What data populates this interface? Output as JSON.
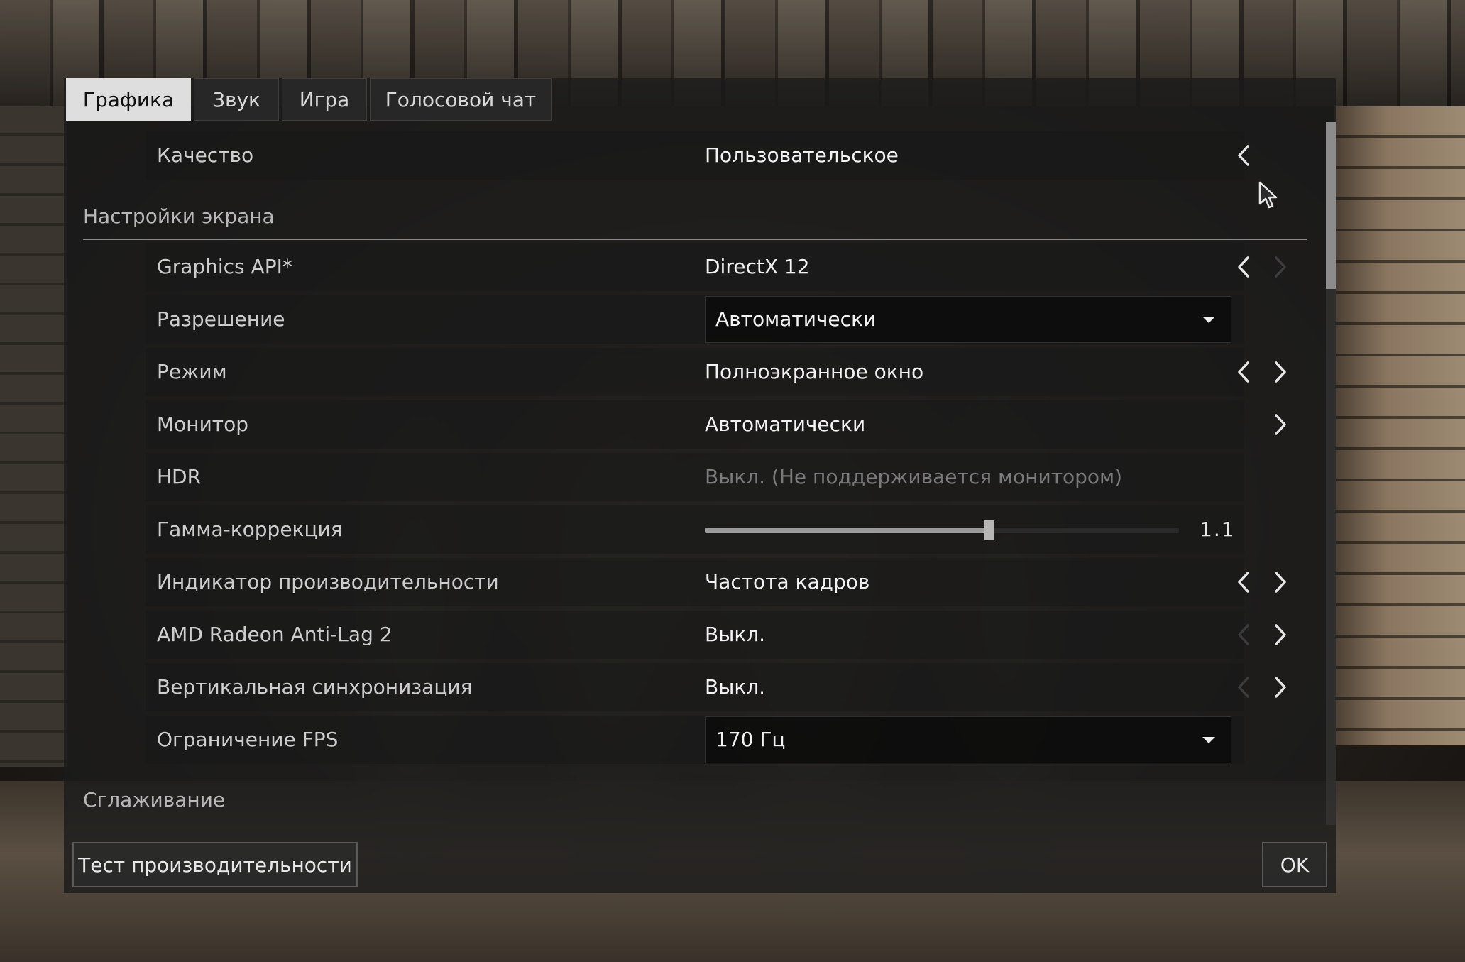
{
  "tabs": [
    {
      "label": "Графика",
      "active": true
    },
    {
      "label": "Звук",
      "active": false
    },
    {
      "label": "Игра",
      "active": false
    },
    {
      "label": "Голосовой чат",
      "active": false
    }
  ],
  "quality": {
    "label": "Качество",
    "value": "Пользовательское"
  },
  "sections": {
    "screen": "Настройки экрана",
    "antialiasing": "Сглаживание"
  },
  "rows": {
    "graphics_api": {
      "label": "Graphics API*",
      "value": "DirectX 12"
    },
    "resolution": {
      "label": "Разрешение",
      "value": "Автоматически"
    },
    "mode": {
      "label": "Режим",
      "value": "Полноэкранное окно"
    },
    "monitor": {
      "label": "Монитор",
      "value": "Автоматически"
    },
    "hdr": {
      "label": "HDR",
      "value": "Выкл. (Не поддерживается монитором)"
    },
    "gamma": {
      "label": "Гамма-коррекция",
      "value": "1.1",
      "fraction": 0.6
    },
    "perf_indicator": {
      "label": "Индикатор производительности",
      "value": "Частота кадров"
    },
    "anti_lag": {
      "label": "AMD Radeon Anti-Lag 2",
      "value": "Выкл."
    },
    "vsync": {
      "label": "Вертикальная синхронизация",
      "value": "Выкл."
    },
    "fps_limit": {
      "label": "Ограничение FPS",
      "value": "170 Гц"
    }
  },
  "buttons": {
    "benchmark": "Тест производительности",
    "ok": "OK"
  },
  "scroll": {
    "position_fraction": 0.0
  }
}
